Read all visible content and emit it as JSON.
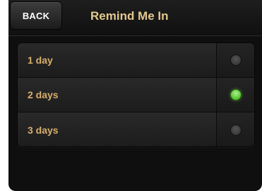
{
  "nav": {
    "back_label": "BACK",
    "title": "Remind Me In"
  },
  "options": [
    {
      "label": "1 day",
      "selected": false
    },
    {
      "label": "2 days",
      "selected": true
    },
    {
      "label": "3 days",
      "selected": false
    }
  ],
  "colors": {
    "title": "#e4c88e",
    "option_label": "#d8ae6c",
    "selected_indicator": "#55c22e",
    "unselected_indicator": "#3a3a3a"
  }
}
